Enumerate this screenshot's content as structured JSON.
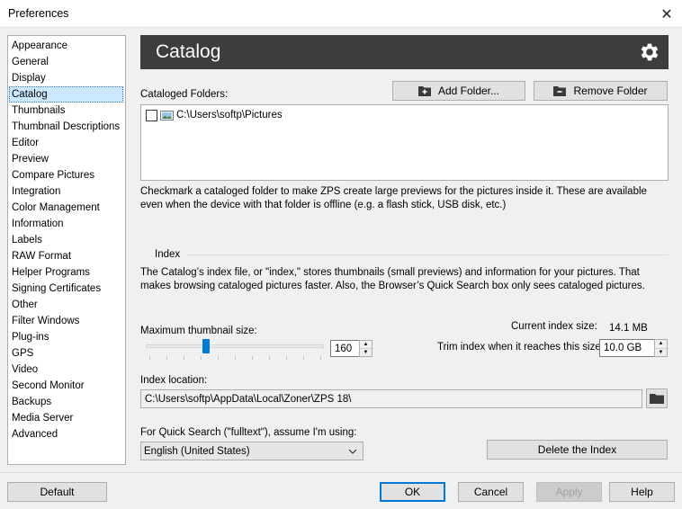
{
  "window": {
    "title": "Preferences",
    "close_glyph": "✕"
  },
  "sidebar": {
    "items": [
      {
        "label": "Appearance"
      },
      {
        "label": "General"
      },
      {
        "label": "Display"
      },
      {
        "label": "Catalog",
        "selected": true
      },
      {
        "label": "Thumbnails"
      },
      {
        "label": "Thumbnail Descriptions"
      },
      {
        "label": "Editor"
      },
      {
        "label": "Preview"
      },
      {
        "label": "Compare Pictures"
      },
      {
        "label": "Integration"
      },
      {
        "label": "Color Management"
      },
      {
        "label": "Information"
      },
      {
        "label": "Labels"
      },
      {
        "label": "RAW Format"
      },
      {
        "label": "Helper Programs"
      },
      {
        "label": "Signing Certificates"
      },
      {
        "label": "Other"
      },
      {
        "label": "Filter Windows"
      },
      {
        "label": "Plug-ins"
      },
      {
        "label": "GPS"
      },
      {
        "label": "Video"
      },
      {
        "label": "Second Monitor"
      },
      {
        "label": "Backups"
      },
      {
        "label": "Media Server"
      },
      {
        "label": "Advanced"
      }
    ]
  },
  "header": {
    "title": "Catalog",
    "icon": "gear-icon"
  },
  "catalog": {
    "folders_label": "Cataloged Folders:",
    "add_folder": "Add Folder...",
    "remove_folder": "Remove Folder",
    "folder_item": "C:\\Users\\softp\\Pictures",
    "folders_description": "Checkmark a cataloged folder to make ZPS create large previews for the pictures inside it. These are available even when the device with that folder is offline (e.g. a flash stick, USB disk, etc.)"
  },
  "index": {
    "section_title": "Index",
    "description": "The Catalog’s index file, or \"index,\" stores thumbnails (small previews) and information for your pictures. That makes browsing cataloged pictures faster. Also, the Browser’s Quick Search box only sees cataloged pictures.",
    "max_thumb_label": "Maximum thumbnail size:",
    "max_thumb_value": "160",
    "max_thumb_fraction": 0.33,
    "current_size_label": "Current index size:",
    "current_size_value": "14.1 MB",
    "trim_label": "Trim index when it reaches this size:",
    "trim_value": "10.0 GB",
    "location_label": "Index location:",
    "location_value": "C:\\Users\\softp\\AppData\\Local\\Zoner\\ZPS 18\\",
    "quick_search_label": "For Quick Search (\"fulltext\"), assume I'm using:",
    "language_value": "English (United States)",
    "delete_button": "Delete the Index"
  },
  "footer": {
    "default": "Default",
    "ok": "OK",
    "cancel": "Cancel",
    "apply": "Apply",
    "help": "Help"
  },
  "colors": {
    "header_bg": "#3d3d3d",
    "selection": "#cce8ff",
    "accent": "#0078d7",
    "slider": "#007ad9"
  }
}
